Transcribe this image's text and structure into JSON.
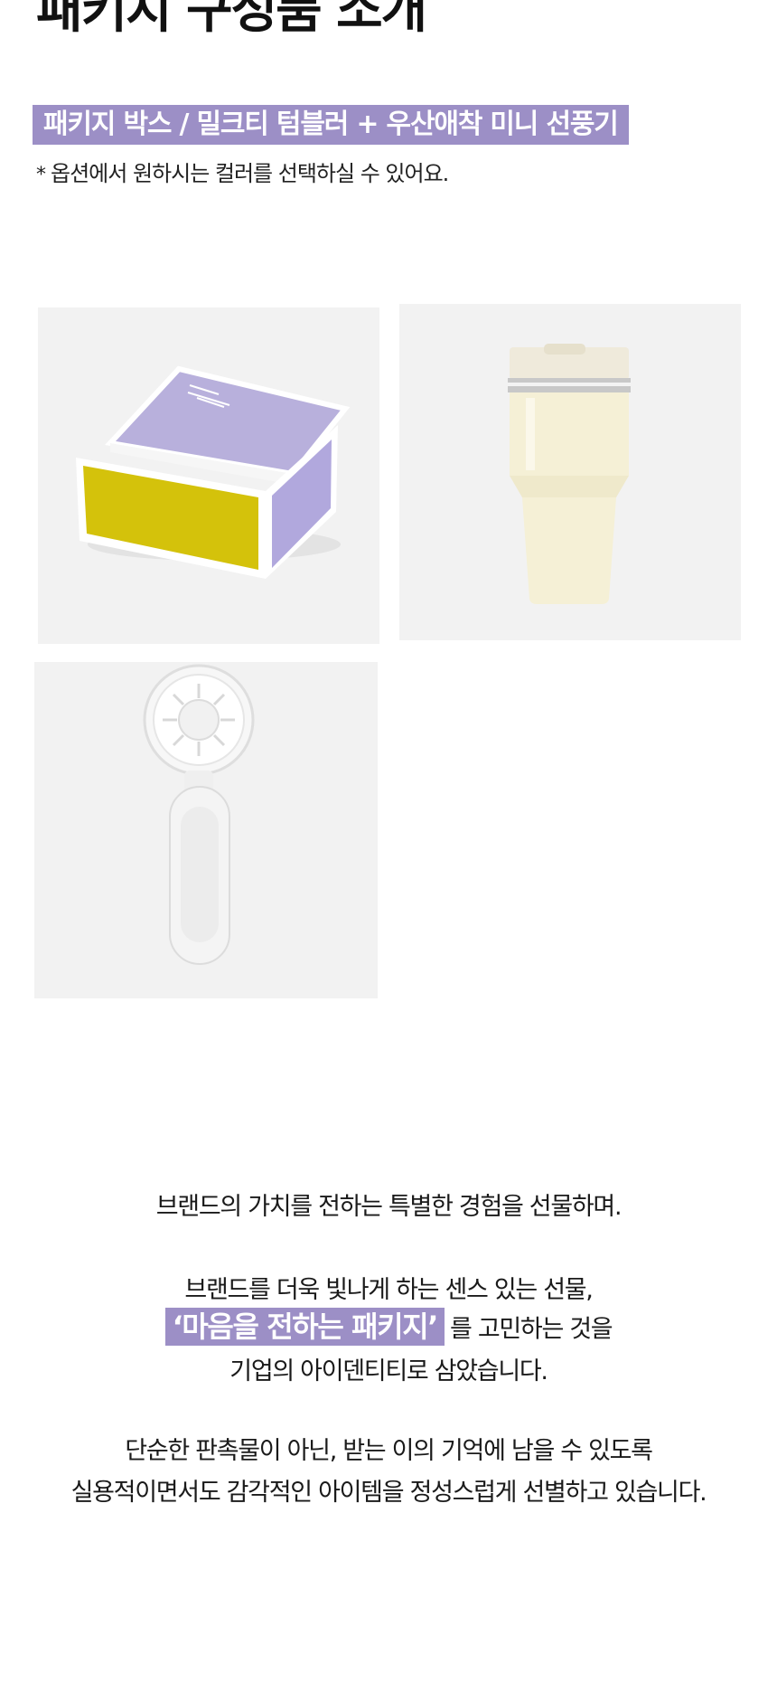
{
  "section": {
    "title": "패키지 구성품 소개"
  },
  "package": {
    "label": "패키지 박스 / 밀크티 텀블러 + 우산애착 미니 선풍기",
    "note_marker": "*",
    "note": "옵션에서 원하시는 컬러를 선택하실 수 있어요."
  },
  "products": [
    {
      "icon": "gift-box-image",
      "colors": {
        "box": "#ffffff",
        "top": "#b8b0dc",
        "side": "#b1a8dd",
        "front": "#d4c20b"
      }
    },
    {
      "icon": "tumbler-image",
      "colors": {
        "body": "#f5f0d6",
        "band": "#c8c8c8"
      }
    },
    {
      "icon": "mini-fan-image",
      "colors": {
        "body": "#f4f4f4"
      }
    }
  ],
  "copy": {
    "line1": "브랜드의 가치를 전하는  특별한 경험을 선물하며.",
    "line2": "브랜드를 더욱 빛나게 하는 센스 있는 선물,",
    "highlight": "‘마음을 전하는 패키지’",
    "line3_rest": "를 고민하는 것을",
    "line4": "기업의 아이덴티티로 삼았습니다.",
    "line5": "단순한 판촉물이 아닌, 받는 이의 기억에 남을 수 있도록",
    "line6": "실용적이면서도 감각적인 아이템을 정성스럽게 선별하고 있습니다."
  },
  "accent_color": "#9c8fc6"
}
